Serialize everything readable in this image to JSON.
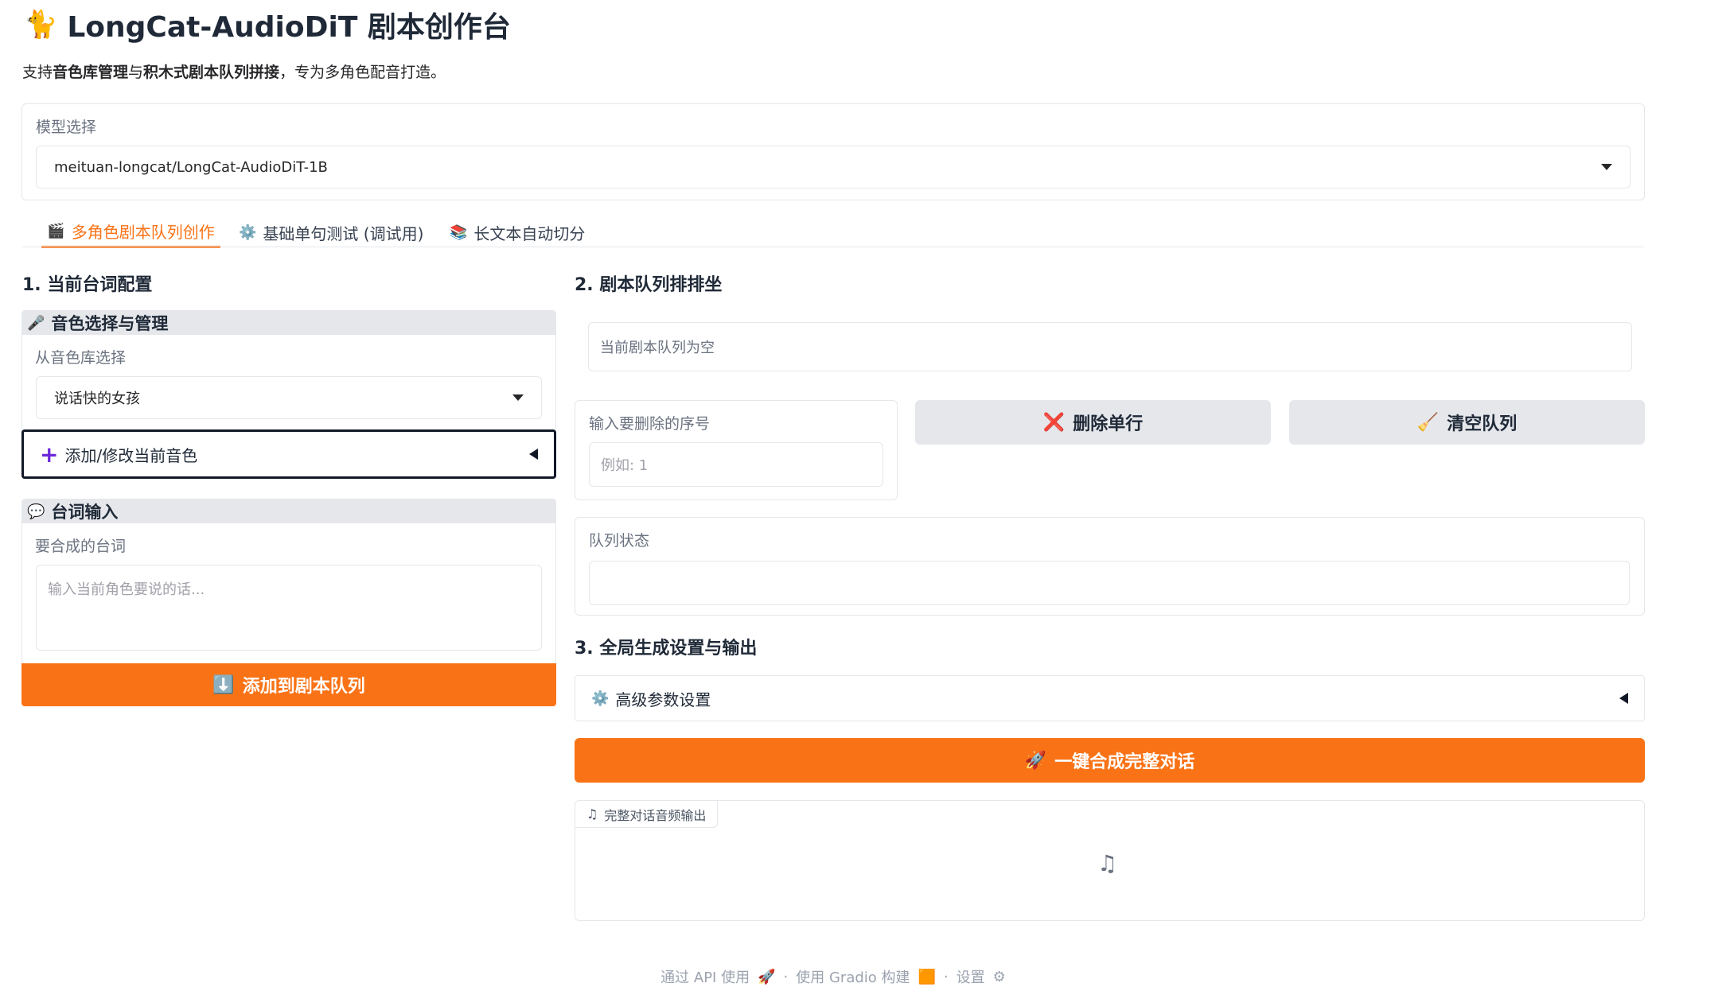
{
  "app": {
    "emoji": "🐈",
    "title": "LongCat-AudioDiT 剧本创作台",
    "subtitle": {
      "p1": "支持",
      "b1": "音色库管理",
      "p2": "与",
      "b2": "积木式剧本队列拼接",
      "p3": "，专为多角色配音打造。"
    }
  },
  "model": {
    "label": "模型选择",
    "value": "meituan-longcat/LongCat-AudioDiT-1B"
  },
  "tabs": [
    {
      "icon": "🎬",
      "label": "多角色剧本队列创作",
      "active": true
    },
    {
      "icon": "⚙️",
      "label": "基础单句测试 (调试用)",
      "active": false
    },
    {
      "icon": "📚",
      "label": "长文本自动切分",
      "active": false
    }
  ],
  "left": {
    "section_title": "1. 当前台词配置",
    "voice_group": {
      "icon": "🎤",
      "title": "音色选择与管理",
      "library_label": "从音色库选择",
      "library_value": "说话快的女孩",
      "add_accordion": "添加/修改当前音色",
      "add_icon": "+"
    },
    "line_group": {
      "icon": "💬",
      "title": "台词输入",
      "text_label": "要合成的台词",
      "text_placeholder": "输入当前角色要说的话..."
    },
    "add_button": {
      "icon": "⬇️",
      "label": "添加到剧本队列"
    }
  },
  "right": {
    "queue_section_title": "2. 剧本队列排排坐",
    "queue_empty": "当前剧本队列为空",
    "delete_index": {
      "label": "输入要删除的序号",
      "placeholder": "例如: 1"
    },
    "delete_button": {
      "icon": "❌",
      "label": "删除单行"
    },
    "clear_button": {
      "icon": "🧹",
      "label": "清空队列"
    },
    "status": {
      "label": "队列状态",
      "value": ""
    },
    "global_section_title": "3. 全局生成设置与输出",
    "advanced": {
      "icon": "⚙️",
      "label": "高级参数设置"
    },
    "generate_button": {
      "icon": "🚀",
      "label": "一键合成完整对话"
    },
    "audio_output": {
      "label": "完整对话音频输出",
      "icon": "♫"
    }
  },
  "footer": {
    "api": "通过 API 使用",
    "api_icon": "🚀",
    "built": "使用 Gradio 构建",
    "built_icon": "🟧",
    "settings": "设置",
    "settings_icon": "⚙",
    "sep": "·"
  },
  "colors": {
    "accent": "#f97316",
    "panel_border": "#e5e7eb",
    "group_header": "#e5e7eb"
  }
}
